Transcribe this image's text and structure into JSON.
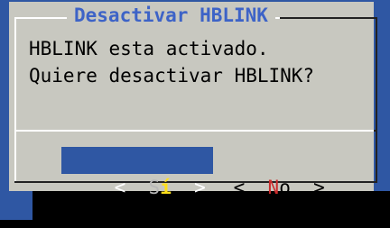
{
  "dialog": {
    "title": "Desactivar HBLINK",
    "line1": "HBLINK esta activado.",
    "line2": "Quiere desactivar HBLINK?",
    "yes_button": {
      "left": "<",
      "hot": "í",
      "first": "S",
      "right": ">"
    },
    "no_button": {
      "left": "<",
      "hot": "N",
      "rest": "o",
      "right": ">"
    }
  },
  "colors": {
    "backdrop": "#2f57a3",
    "dialog": "#c8c8c0",
    "title": "#3d63c7",
    "hotkey_yes": "#ffe01a",
    "hotkey_no": "#cc2b2b"
  }
}
